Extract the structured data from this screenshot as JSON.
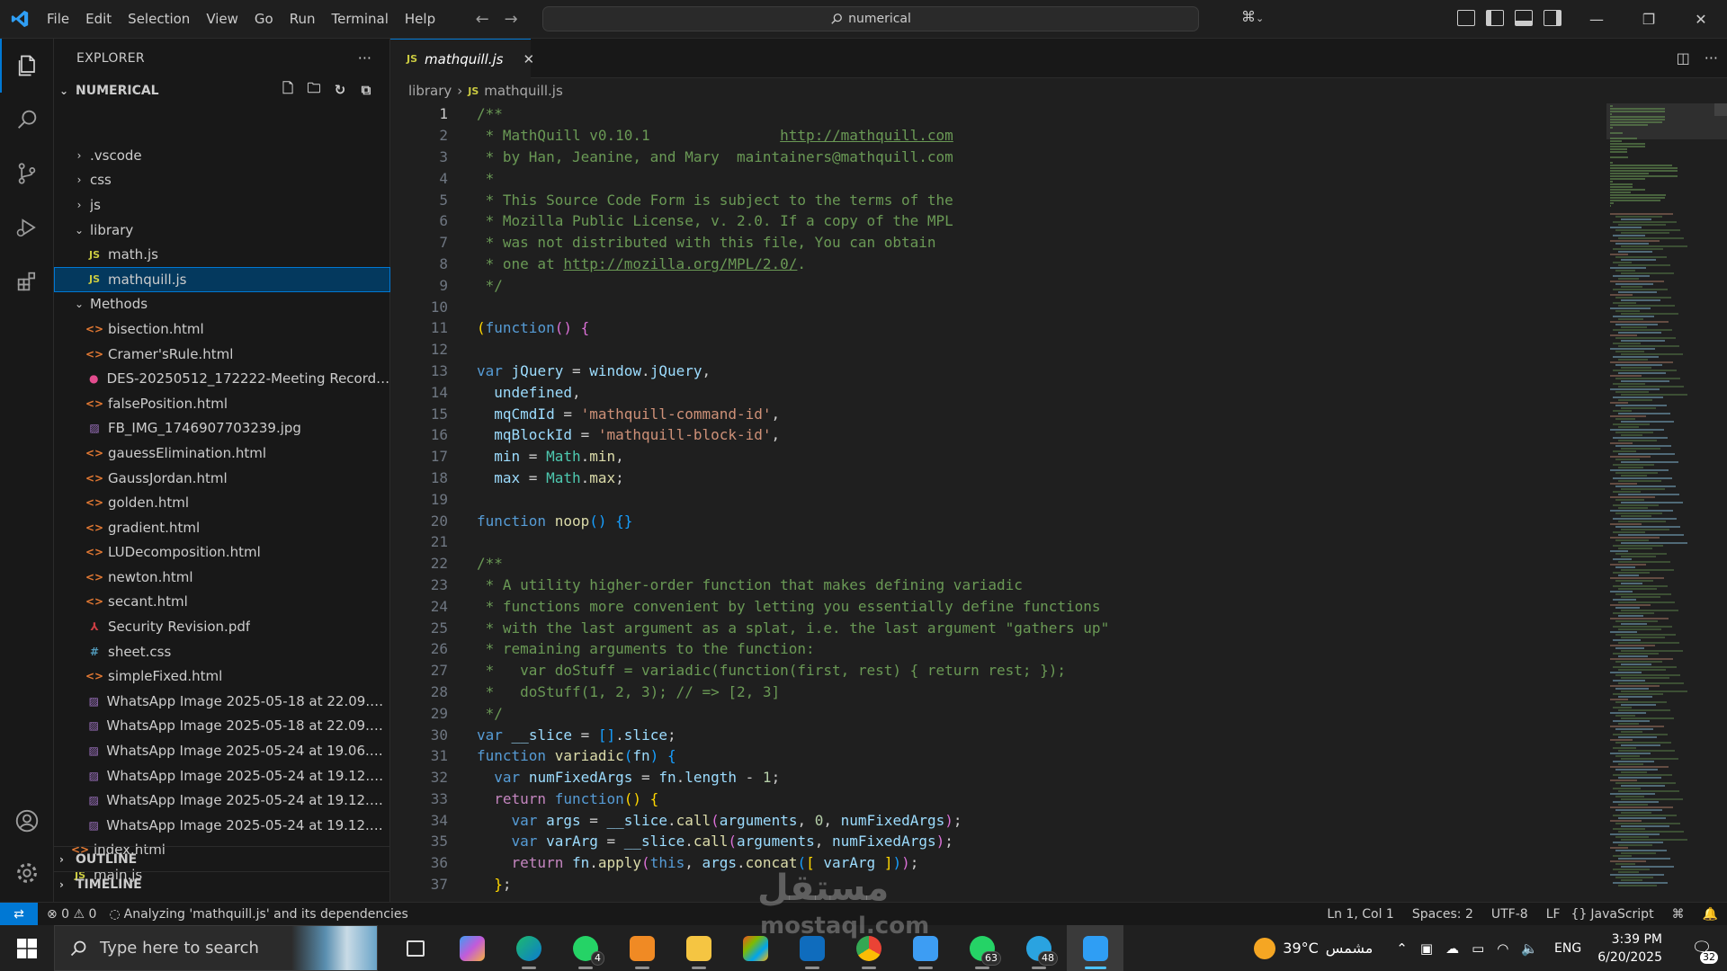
{
  "titlebar": {
    "menu": [
      "File",
      "Edit",
      "Selection",
      "View",
      "Go",
      "Run",
      "Terminal",
      "Help"
    ],
    "command_center": "numerical"
  },
  "explorer": {
    "title": "EXPLORER",
    "folder": "NUMERICAL",
    "tree": [
      {
        "depth": 1,
        "type": "folder",
        "open": false,
        "name": ".vscode"
      },
      {
        "depth": 1,
        "type": "folder",
        "open": false,
        "name": "css"
      },
      {
        "depth": 1,
        "type": "folder",
        "open": false,
        "name": "js"
      },
      {
        "depth": 1,
        "type": "folder",
        "open": true,
        "name": "library"
      },
      {
        "depth": 2,
        "type": "js",
        "name": "math.js"
      },
      {
        "depth": 2,
        "type": "js",
        "name": "mathquill.js",
        "selected": true
      },
      {
        "depth": 1,
        "type": "folder",
        "open": true,
        "name": "Methods"
      },
      {
        "depth": 2,
        "type": "html",
        "name": "bisection.html"
      },
      {
        "depth": 2,
        "type": "html",
        "name": "Cramer'sRule.html"
      },
      {
        "depth": 2,
        "type": "video",
        "name": "DES-20250512_172222-Meeting Recording..."
      },
      {
        "depth": 2,
        "type": "html",
        "name": "falsePosition.html"
      },
      {
        "depth": 2,
        "type": "image",
        "name": "FB_IMG_1746907703239.jpg"
      },
      {
        "depth": 2,
        "type": "html",
        "name": "gauessElimination.html"
      },
      {
        "depth": 2,
        "type": "html",
        "name": "GaussJordan.html"
      },
      {
        "depth": 2,
        "type": "html",
        "name": "golden.html"
      },
      {
        "depth": 2,
        "type": "html",
        "name": "gradient.html"
      },
      {
        "depth": 2,
        "type": "html",
        "name": "LUDecomposition.html"
      },
      {
        "depth": 2,
        "type": "html",
        "name": "newton.html"
      },
      {
        "depth": 2,
        "type": "html",
        "name": "secant.html"
      },
      {
        "depth": 2,
        "type": "pdf",
        "name": "Security Revision.pdf"
      },
      {
        "depth": 2,
        "type": "css",
        "name": "sheet.css"
      },
      {
        "depth": 2,
        "type": "html",
        "name": "simpleFixed.html"
      },
      {
        "depth": 2,
        "type": "image",
        "name": "WhatsApp Image 2025-05-18 at 22.09.04_f..."
      },
      {
        "depth": 2,
        "type": "image",
        "name": "WhatsApp Image 2025-05-18 at 22.09.15_c..."
      },
      {
        "depth": 2,
        "type": "image",
        "name": "WhatsApp Image 2025-05-24 at 19.06.53_6..."
      },
      {
        "depth": 2,
        "type": "image",
        "name": "WhatsApp Image 2025-05-24 at 19.12.47_f..."
      },
      {
        "depth": 2,
        "type": "image",
        "name": "WhatsApp Image 2025-05-24 at 19.12.48_e..."
      },
      {
        "depth": 2,
        "type": "image",
        "name": "WhatsApp Image 2025-05-24 at 19.12.49_9..."
      },
      {
        "depth": 1,
        "type": "html",
        "name": "index.html"
      },
      {
        "depth": 1,
        "type": "js",
        "name": "main.js"
      }
    ],
    "outline": "OUTLINE",
    "timeline": "TIMELINE"
  },
  "editor": {
    "tab_label": "mathquill.js",
    "tab_icon": "JS",
    "breadcrumb": [
      "library",
      "mathquill.js"
    ],
    "current_line": 1,
    "lines": [
      [
        [
          "c",
          "/**"
        ]
      ],
      [
        [
          "c",
          " * MathQuill v0.10.1               "
        ],
        [
          "u",
          "http://mathquill.com"
        ]
      ],
      [
        [
          "c",
          " * by Han, Jeanine, and Mary  maintainers@mathquill.com"
        ]
      ],
      [
        [
          "c",
          " *"
        ]
      ],
      [
        [
          "c",
          " * This Source Code Form is subject to the terms of the"
        ]
      ],
      [
        [
          "c",
          " * Mozilla Public License, v. 2.0. If a copy of the MPL"
        ]
      ],
      [
        [
          "c",
          " * was not distributed with this file, You can obtain"
        ]
      ],
      [
        [
          "c",
          " * one at "
        ],
        [
          "u",
          "http://mozilla.org/MPL/2.0/"
        ],
        [
          "c",
          "."
        ]
      ],
      [
        [
          "c",
          " */"
        ]
      ],
      [],
      [
        [
          "p1",
          "("
        ],
        [
          "k",
          "function"
        ],
        [
          "p2",
          "()"
        ],
        [
          "t",
          " "
        ],
        [
          "p2",
          "{"
        ]
      ],
      [],
      [
        [
          "k",
          "var"
        ],
        [
          "t",
          " "
        ],
        [
          "v",
          "jQuery"
        ],
        [
          "t",
          " = "
        ],
        [
          "v",
          "window"
        ],
        [
          "t",
          "."
        ],
        [
          "v",
          "jQuery"
        ],
        [
          "t",
          ","
        ]
      ],
      [
        [
          "t",
          "  "
        ],
        [
          "v",
          "undefined"
        ],
        [
          "t",
          ","
        ]
      ],
      [
        [
          "t",
          "  "
        ],
        [
          "v",
          "mqCmdId"
        ],
        [
          "t",
          " = "
        ],
        [
          "s",
          "'mathquill-command-id'"
        ],
        [
          "t",
          ","
        ]
      ],
      [
        [
          "t",
          "  "
        ],
        [
          "v",
          "mqBlockId"
        ],
        [
          "t",
          " = "
        ],
        [
          "s",
          "'mathquill-block-id'"
        ],
        [
          "t",
          ","
        ]
      ],
      [
        [
          "t",
          "  "
        ],
        [
          "v",
          "min"
        ],
        [
          "t",
          " = "
        ],
        [
          "ty",
          "Math"
        ],
        [
          "t",
          "."
        ],
        [
          "f",
          "min"
        ],
        [
          "t",
          ","
        ]
      ],
      [
        [
          "t",
          "  "
        ],
        [
          "v",
          "max"
        ],
        [
          "t",
          " = "
        ],
        [
          "ty",
          "Math"
        ],
        [
          "t",
          "."
        ],
        [
          "f",
          "max"
        ],
        [
          "t",
          ";"
        ]
      ],
      [],
      [
        [
          "k",
          "function"
        ],
        [
          "t",
          " "
        ],
        [
          "f",
          "noop"
        ],
        [
          "p3",
          "()"
        ],
        [
          "t",
          " "
        ],
        [
          "p3",
          "{}"
        ]
      ],
      [],
      [
        [
          "c",
          "/**"
        ]
      ],
      [
        [
          "c",
          " * A utility higher-order function that makes defining variadic"
        ]
      ],
      [
        [
          "c",
          " * functions more convenient by letting you essentially define functions"
        ]
      ],
      [
        [
          "c",
          " * with the last argument as a splat, i.e. the last argument \"gathers up\""
        ]
      ],
      [
        [
          "c",
          " * remaining arguments to the function:"
        ]
      ],
      [
        [
          "c",
          " *   var doStuff = variadic(function(first, rest) { return rest; });"
        ]
      ],
      [
        [
          "c",
          " *   doStuff(1, 2, 3); // => [2, 3]"
        ]
      ],
      [
        [
          "c",
          " */"
        ]
      ],
      [
        [
          "k",
          "var"
        ],
        [
          "t",
          " "
        ],
        [
          "v",
          "__slice"
        ],
        [
          "t",
          " = "
        ],
        [
          "p3",
          "[]"
        ],
        [
          "t",
          "."
        ],
        [
          "v",
          "slice"
        ],
        [
          "t",
          ";"
        ]
      ],
      [
        [
          "k",
          "function"
        ],
        [
          "t",
          " "
        ],
        [
          "f",
          "variadic"
        ],
        [
          "p3",
          "("
        ],
        [
          "v",
          "fn"
        ],
        [
          "p3",
          ")"
        ],
        [
          "t",
          " "
        ],
        [
          "p3",
          "{"
        ]
      ],
      [
        [
          "t",
          "  "
        ],
        [
          "k",
          "var"
        ],
        [
          "t",
          " "
        ],
        [
          "v",
          "numFixedArgs"
        ],
        [
          "t",
          " = "
        ],
        [
          "v",
          "fn"
        ],
        [
          "t",
          "."
        ],
        [
          "v",
          "length"
        ],
        [
          "t",
          " - "
        ],
        [
          "n",
          "1"
        ],
        [
          "t",
          ";"
        ]
      ],
      [
        [
          "t",
          "  "
        ],
        [
          "kc",
          "return"
        ],
        [
          "t",
          " "
        ],
        [
          "k",
          "function"
        ],
        [
          "p1",
          "()"
        ],
        [
          "t",
          " "
        ],
        [
          "p1",
          "{"
        ]
      ],
      [
        [
          "t",
          "    "
        ],
        [
          "k",
          "var"
        ],
        [
          "t",
          " "
        ],
        [
          "v",
          "args"
        ],
        [
          "t",
          " = "
        ],
        [
          "v",
          "__slice"
        ],
        [
          "t",
          "."
        ],
        [
          "f",
          "call"
        ],
        [
          "p2",
          "("
        ],
        [
          "v",
          "arguments"
        ],
        [
          "t",
          ", "
        ],
        [
          "n",
          "0"
        ],
        [
          "t",
          ", "
        ],
        [
          "v",
          "numFixedArgs"
        ],
        [
          "p2",
          ")"
        ],
        [
          "t",
          ";"
        ]
      ],
      [
        [
          "t",
          "    "
        ],
        [
          "k",
          "var"
        ],
        [
          "t",
          " "
        ],
        [
          "v",
          "varArg"
        ],
        [
          "t",
          " = "
        ],
        [
          "v",
          "__slice"
        ],
        [
          "t",
          "."
        ],
        [
          "f",
          "call"
        ],
        [
          "p2",
          "("
        ],
        [
          "v",
          "arguments"
        ],
        [
          "t",
          ", "
        ],
        [
          "v",
          "numFixedArgs"
        ],
        [
          "p2",
          ")"
        ],
        [
          "t",
          ";"
        ]
      ],
      [
        [
          "t",
          "    "
        ],
        [
          "kc",
          "return"
        ],
        [
          "t",
          " "
        ],
        [
          "v",
          "fn"
        ],
        [
          "t",
          "."
        ],
        [
          "f",
          "apply"
        ],
        [
          "p2",
          "("
        ],
        [
          "k",
          "this"
        ],
        [
          "t",
          ", "
        ],
        [
          "v",
          "args"
        ],
        [
          "t",
          "."
        ],
        [
          "f",
          "concat"
        ],
        [
          "p3",
          "("
        ],
        [
          "p1",
          "["
        ],
        [
          "t",
          " "
        ],
        [
          "v",
          "varArg"
        ],
        [
          "t",
          " "
        ],
        [
          "p1",
          "]"
        ],
        [
          "p3",
          ")"
        ],
        [
          "p2",
          ")"
        ],
        [
          "t",
          ";"
        ]
      ],
      [
        [
          "t",
          "  "
        ],
        [
          "p1",
          "}"
        ],
        [
          "t",
          ";"
        ]
      ],
      [
        [
          "p3",
          "}"
        ]
      ]
    ]
  },
  "statusbar": {
    "problems": "⊗ 0 ⚠ 0",
    "analyzing": "Analyzing 'mathquill.js' and its dependencies",
    "position": "Ln 1, Col 1",
    "spaces": "Spaces: 2",
    "encoding": "UTF-8",
    "eol": "LF",
    "language": "JavaScript"
  },
  "taskbar": {
    "search_placeholder": "Type here to search",
    "apps": [
      {
        "icon": "task-view-icon"
      },
      {
        "icon": "copilot-icon"
      },
      {
        "icon": "edge-icon"
      },
      {
        "icon": "whatsapp-icon",
        "badge": "4"
      },
      {
        "icon": "media-player-icon"
      },
      {
        "icon": "file-explorer-icon"
      },
      {
        "icon": "microsoft-store-icon"
      },
      {
        "icon": "outlook-icon"
      },
      {
        "icon": "chrome-icon"
      },
      {
        "icon": "bluesky-icon"
      },
      {
        "icon": "whatsapp-icon",
        "badge": "63"
      },
      {
        "icon": "telegram-icon",
        "badge": "48"
      },
      {
        "icon": "vscode-icon",
        "active": true
      }
    ],
    "weather_temp": "39°C",
    "weather_text": "مشمس",
    "language": "ENG",
    "time": "3:39 PM",
    "date": "6/20/2025",
    "notifications": "32"
  },
  "watermark": {
    "main": "مستقل",
    "sub": "mostaql.com"
  },
  "colors": {
    "accent": "#0078d4",
    "selection": "#04395e",
    "comment": "#6a9955",
    "keyword": "#569cd6",
    "string": "#ce9178"
  }
}
